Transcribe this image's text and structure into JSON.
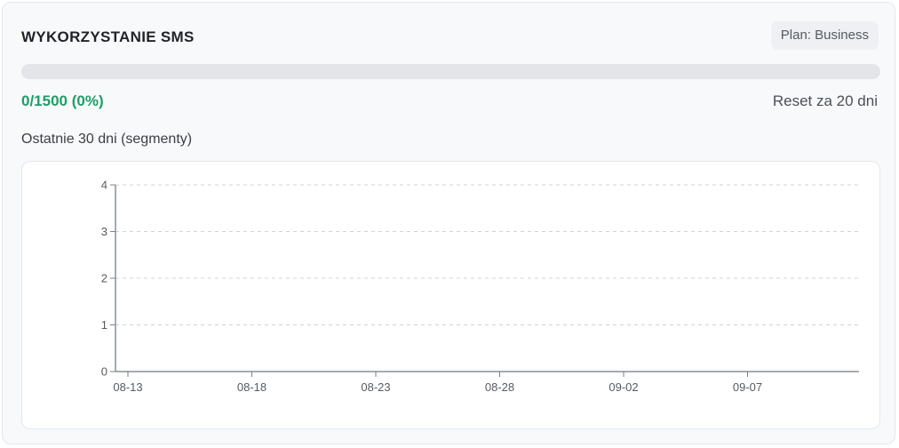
{
  "widget": {
    "title": "WYKORZYSTANIE SMS",
    "plan_badge": "Plan: Business",
    "usage_text": "0/1500 (0%)",
    "usage_fraction": 0,
    "reset_text": "Reset za 20 dni",
    "chart_label": "Ostatnie 30 dni (segmenty)"
  },
  "colors": {
    "accent_green": "#1e9e67",
    "track_gray": "#e3e5e8"
  },
  "chart_data": {
    "type": "bar",
    "x_tick_labels": [
      "08-13",
      "08-18",
      "08-23",
      "08-28",
      "09-02",
      "09-07"
    ],
    "y_ticks": [
      0,
      1,
      2,
      3,
      4
    ],
    "ylim": [
      0,
      4
    ],
    "grid": "horizontal-dashed",
    "series": [
      {
        "values": []
      }
    ]
  }
}
